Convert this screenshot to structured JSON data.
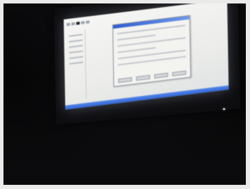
{
  "scene": {
    "description_type": "photo",
    "colors": {
      "background": "#050505",
      "screen": "#f0f1ee",
      "taskbar": "#2c64d8",
      "dialog_title": "#2f5fd0"
    }
  }
}
